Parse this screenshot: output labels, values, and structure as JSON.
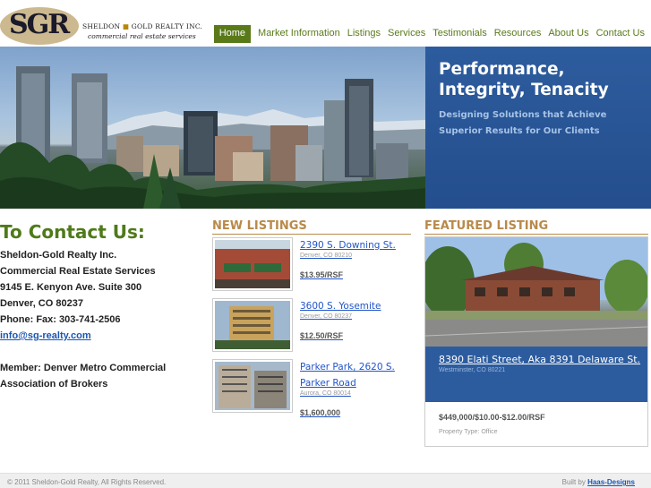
{
  "logo": {
    "mark": "SGR",
    "name_part1": "SHELDON",
    "name_part2": "GOLD REALTY INC.",
    "tagline": "commercial real estate services"
  },
  "nav": {
    "items": [
      "Home",
      "Market Information",
      "Listings",
      "Services",
      "Testimonials",
      "Resources",
      "About Us",
      "Contact Us"
    ],
    "active": "Home"
  },
  "hero": {
    "title": "Performance,\nIntegrity, Tenacity",
    "subtitle": "Designing Solutions that Achieve\nSuperior Results for Our Clients"
  },
  "contact": {
    "heading": "To Contact Us:",
    "lines": [
      "Sheldon-Gold Realty Inc.",
      "Commercial Real Estate Services",
      "9145 E. Kenyon Ave. Suite 300",
      "Denver, CO 80237",
      "Phone: Fax: 303-741-2506"
    ],
    "email": "info@sg-realty.com",
    "member_line1": "Member: Denver Metro Commercial",
    "member_line2": "Association of Brokers"
  },
  "new_listings": {
    "heading": "NEW LISTINGS",
    "items": [
      {
        "title": "2390 S. Downing St.",
        "city": "Denver, CO 80210",
        "price": "$13.95/RSF"
      },
      {
        "title": "3600 S. Yosemite",
        "city": "Denver, CO 80237",
        "price": "$12.50/RSF"
      },
      {
        "title": "Parker Park, 2620 S. Parker Road",
        "city": "Aurora, CO 80014",
        "price": "$1,600,000"
      }
    ]
  },
  "featured": {
    "heading": "FEATURED LISTING",
    "title": "8390 Elati Street, Aka 8391 Delaware St.",
    "city": "Westminster, CO 80221",
    "price": "$449,000/$10.00-$12.00/RSF",
    "type": "Property Type: Office"
  },
  "footer": {
    "copyright": "© 2011 Sheldon-Gold Realty, All Rights Reserved.",
    "built_prefix": "Built by",
    "built_link": "Haas-Designs"
  }
}
